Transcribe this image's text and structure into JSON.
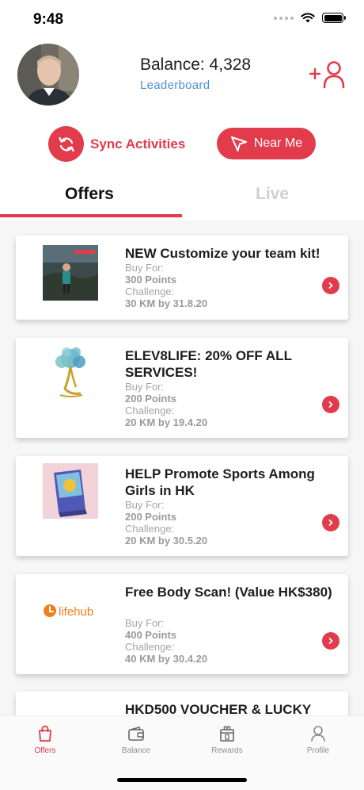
{
  "status_bar": {
    "time": "9:48"
  },
  "header": {
    "balance": "Balance: 4,328",
    "leaderboard": "Leaderboard"
  },
  "actions": {
    "sync_label": "Sync Activities",
    "near_label": "Near Me"
  },
  "tabs": [
    {
      "label": "Offers",
      "active": true
    },
    {
      "label": "Live",
      "active": false
    }
  ],
  "offers": [
    {
      "title": "NEW Customize your team kit!",
      "buy_for_label": "Buy For:",
      "points": "300 Points",
      "challenge_label": "Challenge:",
      "challenge": "30 KM by 31.8.20",
      "icon": "team-kit-photo"
    },
    {
      "title": "ELEV8LIFE: 20% OFF ALL SERVICES!",
      "buy_for_label": "Buy For:",
      "points": "200 Points",
      "challenge_label": "Challenge:",
      "challenge": "20 KM by 19.4.20",
      "icon": "elev8life-tree-logo"
    },
    {
      "title": "HELP Promote Sports Among Girls in HK",
      "buy_for_label": "Buy For:",
      "points": "200 Points",
      "challenge_label": "Challenge:",
      "challenge": "20 KM by 30.5.20",
      "icon": "book-cover-photo"
    },
    {
      "title": "Free Body Scan! (Value HK$380)",
      "buy_for_label": "Buy For:",
      "points": "400 Points",
      "challenge_label": "Challenge:",
      "challenge": "40 KM by 30.4.20",
      "icon": "lifehub-logo",
      "logo_text": "lifehub"
    },
    {
      "title": "HKD500 VOUCHER & LUCKY",
      "icon": "voucher-logo"
    }
  ],
  "tabbar": [
    {
      "label": "Offers",
      "icon": "bag-icon",
      "active": true
    },
    {
      "label": "Balance",
      "icon": "wallet-icon",
      "active": false
    },
    {
      "label": "Rewards",
      "icon": "gift-icon",
      "active": false
    },
    {
      "label": "Profile",
      "icon": "person-icon",
      "active": false
    }
  ],
  "colors": {
    "accent": "#e23b4b",
    "link": "#4a90d9",
    "muted": "#a5a5a5"
  }
}
